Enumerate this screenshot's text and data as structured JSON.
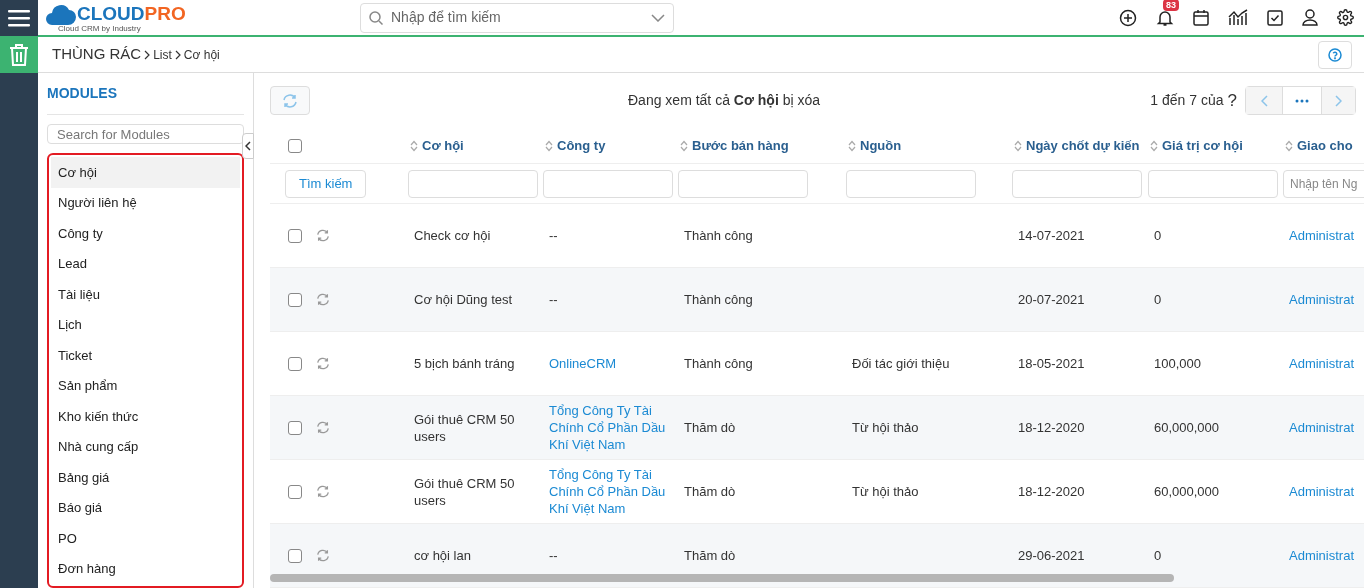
{
  "header": {
    "logo": {
      "brand_a": "CLOUD",
      "brand_b": "PRO",
      "tagline": "Cloud CRM by Industry"
    },
    "search": {
      "placeholder": "Nhập để tìm kiếm"
    },
    "notification_count": "83"
  },
  "breadcrumb": {
    "title": "THÙNG RÁC",
    "items": [
      "List",
      "Cơ hội"
    ]
  },
  "sidebar": {
    "heading": "MODULES",
    "search": {
      "placeholder": "Search for Modules"
    },
    "highlighted": true,
    "items": [
      {
        "label": "Cơ hội",
        "selected": true
      },
      {
        "label": "Người liên hệ",
        "selected": false
      },
      {
        "label": "Công ty",
        "selected": false
      },
      {
        "label": "Lead",
        "selected": false
      },
      {
        "label": "Tài liệu",
        "selected": false
      },
      {
        "label": "Lịch",
        "selected": false
      },
      {
        "label": "Ticket",
        "selected": false
      },
      {
        "label": "Sản phẩm",
        "selected": false
      },
      {
        "label": "Kho kiến thức",
        "selected": false
      },
      {
        "label": "Nhà cung cấp",
        "selected": false
      },
      {
        "label": "Bảng giá",
        "selected": false
      },
      {
        "label": "Báo giá",
        "selected": false
      },
      {
        "label": "PO",
        "selected": false
      },
      {
        "label": "Đơn hàng",
        "selected": false
      }
    ]
  },
  "list": {
    "summary": "Đang xem tất cả **Cơ hội** bị xóa",
    "pagination": {
      "range": "1 đến 7 của",
      "total": "?"
    },
    "search_button": "Tìm kiếm",
    "all_checked": false,
    "columns": [
      {
        "label": "Cơ hội"
      },
      {
        "label": "Công ty"
      },
      {
        "label": "Bước bán hàng"
      },
      {
        "label": "Nguồn"
      },
      {
        "label": "Ngày chốt dự kiến"
      },
      {
        "label": "Giá trị cơ hội"
      },
      {
        "label": "Giao cho",
        "filter_placeholder": "Nhập tên Ng"
      }
    ],
    "rows": [
      {
        "checked": false,
        "cells": [
          {
            "text": "Check cơ hội",
            "link": false
          },
          {
            "text": "--",
            "link": false
          },
          {
            "text": "Thành công",
            "link": false
          },
          null,
          {
            "text": "14-07-2021",
            "link": false
          },
          {
            "text": "0",
            "link": false
          },
          {
            "text": "Administrat",
            "link": true
          }
        ]
      },
      {
        "checked": false,
        "cells": [
          {
            "text": "Cơ hội Dũng test",
            "link": false
          },
          {
            "text": "--",
            "link": false
          },
          {
            "text": "Thành công",
            "link": false
          },
          null,
          {
            "text": "20-07-2021",
            "link": false
          },
          {
            "text": "0",
            "link": false
          },
          {
            "text": "Administrat",
            "link": true
          }
        ]
      },
      {
        "checked": false,
        "cells": [
          {
            "text": "5 bịch bánh tráng",
            "link": false
          },
          {
            "text": "OnlineCRM",
            "link": true
          },
          {
            "text": "Thành công",
            "link": false
          },
          {
            "text": "Đối tác giới thiệu",
            "link": false
          },
          {
            "text": "18-05-2021",
            "link": false
          },
          {
            "text": "100,000",
            "link": false
          },
          {
            "text": "Administrat",
            "link": true
          }
        ]
      },
      {
        "checked": false,
        "cells": [
          {
            "text": "Gói thuê CRM 50 users",
            "link": false
          },
          {
            "text": "Tổng Công Ty Tài Chính Cổ Phần Dầu Khí Việt Nam",
            "link": true
          },
          {
            "text": "Thăm dò",
            "link": false
          },
          {
            "text": "Từ hội thảo",
            "link": false
          },
          {
            "text": "18-12-2020",
            "link": false
          },
          {
            "text": "60,000,000",
            "link": false
          },
          {
            "text": "Administrat",
            "link": true
          }
        ]
      },
      {
        "checked": false,
        "cells": [
          {
            "text": "Gói thuê CRM 50 users",
            "link": false
          },
          {
            "text": "Tổng Công Ty Tài Chính Cổ Phần Dầu Khí Việt Nam",
            "link": true
          },
          {
            "text": "Thăm dò",
            "link": false
          },
          {
            "text": "Từ hội thảo",
            "link": false
          },
          {
            "text": "18-12-2020",
            "link": false
          },
          {
            "text": "60,000,000",
            "link": false
          },
          {
            "text": "Administrat",
            "link": true
          }
        ]
      },
      {
        "checked": false,
        "cells": [
          {
            "text": "cơ hội lan",
            "link": false
          },
          {
            "text": "--",
            "link": false
          },
          {
            "text": "Thăm dò",
            "link": false
          },
          null,
          {
            "text": "29-06-2021",
            "link": false
          },
          {
            "text": "0",
            "link": false
          },
          {
            "text": "Administrat",
            "link": true
          }
        ]
      }
    ]
  }
}
